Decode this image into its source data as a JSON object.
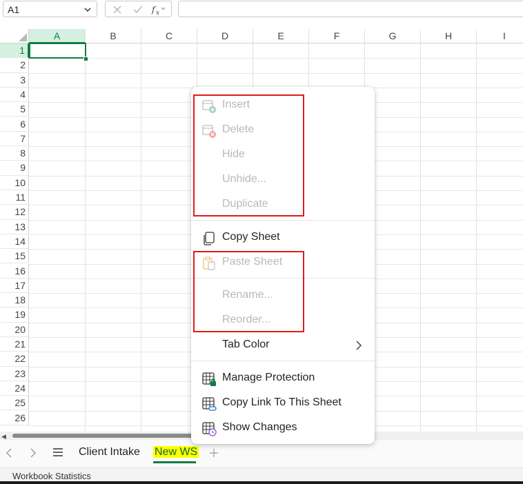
{
  "formula_bar": {
    "name_box": "A1",
    "formula": ""
  },
  "grid": {
    "columns": [
      "A",
      "B",
      "C",
      "D",
      "E",
      "F",
      "G",
      "H",
      "I"
    ],
    "rows": [
      "1",
      "2",
      "3",
      "4",
      "5",
      "6",
      "7",
      "8",
      "9",
      "10",
      "11",
      "12",
      "13",
      "14",
      "15",
      "16",
      "17",
      "18",
      "19",
      "20",
      "21",
      "22",
      "23",
      "24",
      "25",
      "26"
    ],
    "selected_cell": "A1"
  },
  "context_menu": {
    "items": [
      {
        "label": "Insert",
        "icon": "insert-sheet-icon",
        "enabled": false
      },
      {
        "label": "Delete",
        "icon": "delete-sheet-icon",
        "enabled": false
      },
      {
        "label": "Hide",
        "icon": "",
        "enabled": false
      },
      {
        "label": "Unhide...",
        "icon": "",
        "enabled": false
      },
      {
        "label": "Duplicate",
        "icon": "",
        "enabled": false
      },
      {
        "label": "Copy Sheet",
        "icon": "copy-icon",
        "enabled": true
      },
      {
        "label": "Paste Sheet",
        "icon": "paste-icon",
        "enabled": false
      },
      {
        "label": "Rename...",
        "icon": "",
        "enabled": false
      },
      {
        "label": "Reorder...",
        "icon": "",
        "enabled": false
      },
      {
        "label": "Tab Color",
        "icon": "",
        "enabled": true,
        "submenu": true
      },
      {
        "label": "Manage Protection",
        "icon": "protect-sheet-icon",
        "enabled": true
      },
      {
        "label": "Copy Link To This Sheet",
        "icon": "link-sheet-icon",
        "enabled": true
      },
      {
        "label": "Show Changes",
        "icon": "show-changes-icon",
        "enabled": true
      }
    ]
  },
  "sheet_tabs": {
    "tabs": [
      {
        "label": "Client Intake",
        "active": false
      },
      {
        "label": "New WS",
        "active": true
      }
    ]
  },
  "status_bar": {
    "text": "Workbook Statistics"
  },
  "colors": {
    "accent": "#107c41",
    "highlight": "#ffff00",
    "annotation": "#e01a1a"
  }
}
